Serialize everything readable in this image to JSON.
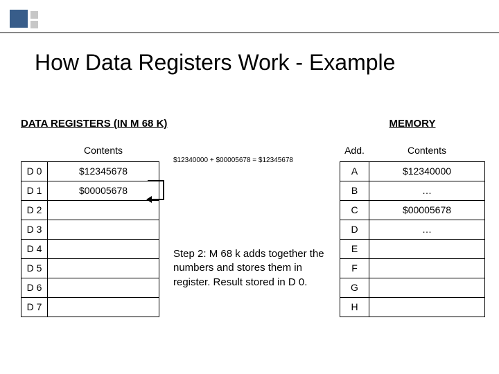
{
  "title": "How Data Registers Work - Example",
  "left": {
    "heading": "DATA REGISTERS (IN M 68 K)",
    "contents_header": "Contents",
    "registers": [
      {
        "name": "D 0",
        "value": "$12345678"
      },
      {
        "name": "D 1",
        "value": "$00005678"
      },
      {
        "name": "D 2",
        "value": ""
      },
      {
        "name": "D 3",
        "value": ""
      },
      {
        "name": "D 4",
        "value": ""
      },
      {
        "name": "D 5",
        "value": ""
      },
      {
        "name": "D 6",
        "value": ""
      },
      {
        "name": "D 7",
        "value": ""
      }
    ]
  },
  "middle": {
    "equation": "$12340000 + $00005678 = $12345678",
    "step_text": "Step 2: M 68 k adds together the numbers and stores them in register. Result stored in D 0."
  },
  "right": {
    "heading": "MEMORY",
    "add_header": "Add.",
    "contents_header": "Contents",
    "rows": [
      {
        "addr": "A",
        "value": "$12340000"
      },
      {
        "addr": "B",
        "value": "…"
      },
      {
        "addr": "C",
        "value": "$00005678"
      },
      {
        "addr": "D",
        "value": "…"
      },
      {
        "addr": "E",
        "value": ""
      },
      {
        "addr": "F",
        "value": ""
      },
      {
        "addr": "G",
        "value": ""
      },
      {
        "addr": "H",
        "value": ""
      }
    ]
  }
}
